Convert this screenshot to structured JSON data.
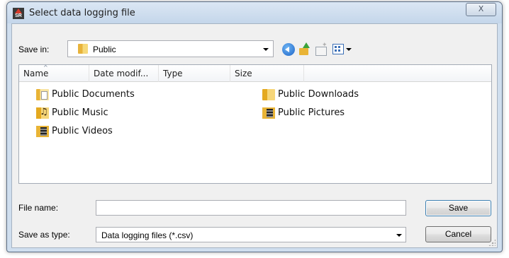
{
  "window": {
    "title": "Select data logging file",
    "close_glyph": "X",
    "app_icon_text": "SR"
  },
  "toolbar": {
    "save_in_label": "Save in:",
    "save_in_value": "Public",
    "icons": [
      "back-icon",
      "up-folder-icon",
      "new-folder-icon",
      "views-menu-icon"
    ]
  },
  "list": {
    "columns": [
      "Name",
      "Date modif...",
      "Type",
      "Size"
    ],
    "sort_column": "Name",
    "items": [
      {
        "label": "Public Documents",
        "icon": "documents-folder-icon"
      },
      {
        "label": "Public Downloads",
        "icon": "downloads-folder-icon"
      },
      {
        "label": "Public Music",
        "icon": "music-folder-icon"
      },
      {
        "label": "Public Pictures",
        "icon": "pictures-folder-icon"
      },
      {
        "label": "Public Videos",
        "icon": "videos-folder-icon"
      }
    ]
  },
  "form": {
    "file_name_label": "File name:",
    "file_name_value": "",
    "save_as_type_label": "Save as type:",
    "save_as_type_value": "Data logging files (*.csv)"
  },
  "buttons": {
    "save": "Save",
    "cancel": "Cancel"
  },
  "colors": {
    "frame": "#cfdeee",
    "client": "#f0f0f0",
    "folder": "#e9b436",
    "back_button": "#1d64c7"
  }
}
